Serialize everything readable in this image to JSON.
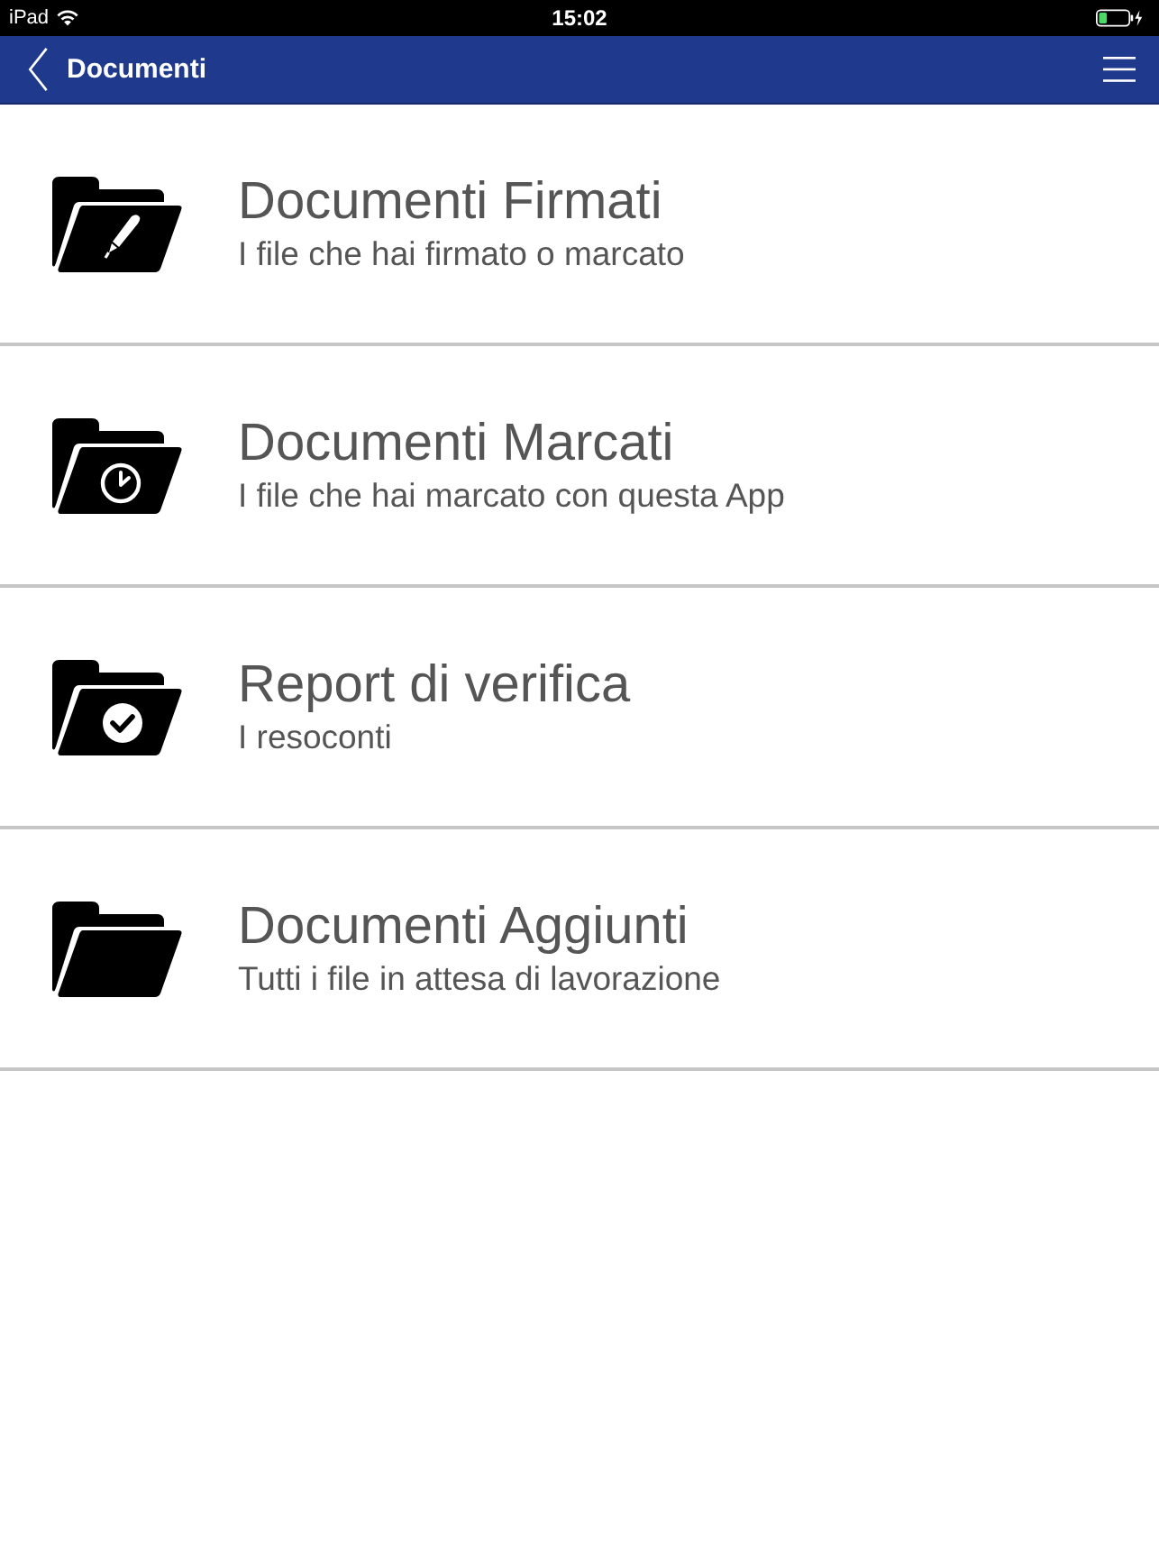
{
  "status_bar": {
    "carrier": "iPad",
    "time": "15:02"
  },
  "nav_bar": {
    "title": "Documenti"
  },
  "items": [
    {
      "kind": "signed",
      "title": "Documenti Firmati",
      "subtitle": "I file che hai firmato o marcato"
    },
    {
      "kind": "timestamped",
      "title": "Documenti Marcati",
      "subtitle": "I file che hai marcato con questa App"
    },
    {
      "kind": "report",
      "title": "Report di verifica",
      "subtitle": "I resoconti"
    },
    {
      "kind": "pending",
      "title": "Documenti Aggiunti",
      "subtitle": "Tutti i file in attesa di lavorazione"
    }
  ]
}
